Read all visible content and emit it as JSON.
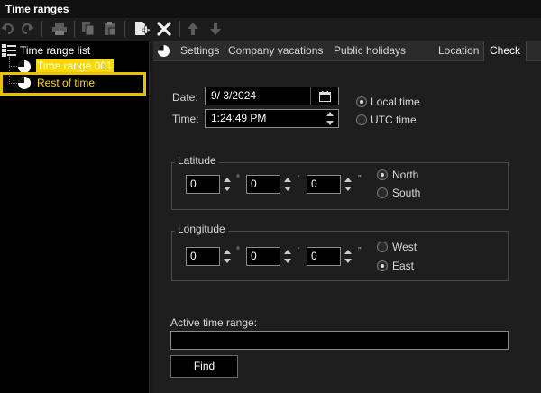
{
  "window": {
    "title": "Time ranges"
  },
  "toolbar": {
    "buttons": [
      {
        "icon": "undo-icon"
      },
      {
        "icon": "redo-icon"
      },
      {
        "icon": "print-icon"
      },
      {
        "icon": "copy-icon"
      },
      {
        "icon": "paste-icon"
      },
      {
        "icon": "new-document-icon"
      },
      {
        "icon": "delete-icon"
      },
      {
        "icon": "arrow-up-icon"
      },
      {
        "icon": "arrow-down-icon"
      }
    ]
  },
  "tree": {
    "root_label": "Time range list",
    "items": [
      {
        "label": "Time range 001",
        "highlighted": true
      },
      {
        "label": "Rest of time",
        "selected": true
      }
    ]
  },
  "tabs": [
    {
      "label": "Settings"
    },
    {
      "label": "Company vacations"
    },
    {
      "label": "Public holidays"
    },
    {
      "label": "Location"
    },
    {
      "label": "Check",
      "active": true
    }
  ],
  "check": {
    "date_label": "Date:",
    "date_value": "9/  3/2024",
    "time_label": "Time:",
    "time_value": "1:24:49 PM",
    "local_time_label": "Local time",
    "utc_time_label": "UTC time",
    "time_mode": "local",
    "latitude": {
      "label": "Latitude",
      "degrees": "0",
      "minutes": "0",
      "seconds": "0",
      "deg_symbol": "°",
      "min_symbol": "'",
      "sec_symbol": "''",
      "north_label": "North",
      "south_label": "South",
      "selected": "north"
    },
    "longitude": {
      "label": "Longitude",
      "degrees": "0",
      "minutes": "0",
      "seconds": "0",
      "deg_symbol": "°",
      "min_symbol": "'",
      "sec_symbol": "''",
      "west_label": "West",
      "east_label": "East",
      "selected": "east"
    },
    "active_range_label": "Active time range:",
    "active_range_value": "",
    "find_label": "Find"
  },
  "colors": {
    "highlight_yellow": "#ffd700",
    "selection_frame": "#e6c200",
    "background": "#1e1e1e",
    "panel_black": "#000000"
  }
}
